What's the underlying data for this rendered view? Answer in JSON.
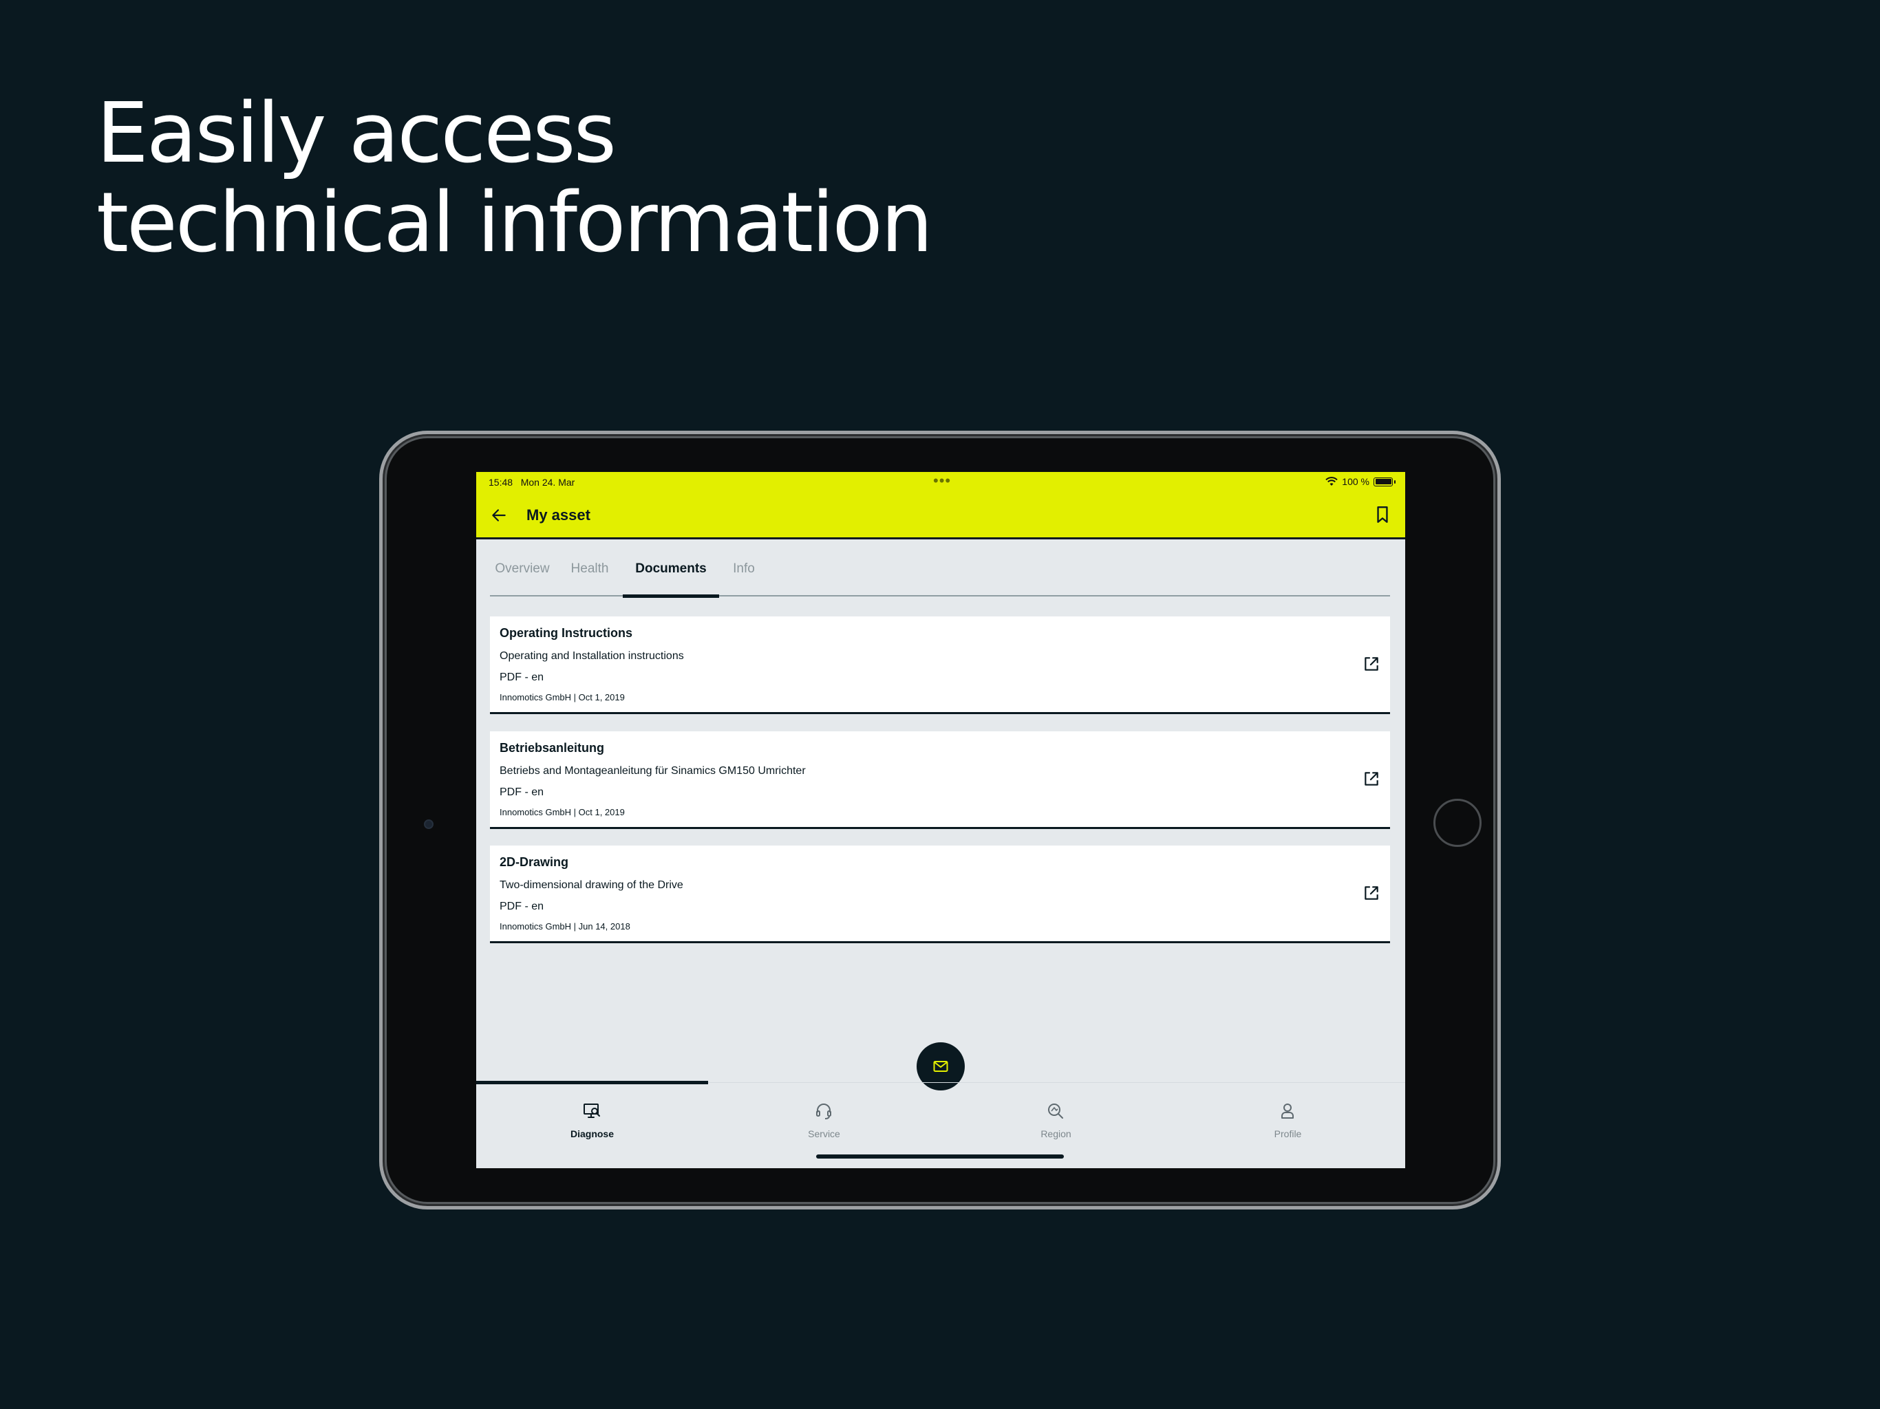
{
  "headline": {
    "line1": "Easily access",
    "line2": "technical information"
  },
  "statusbar": {
    "time": "15:48",
    "date": "Mon 24. Mar",
    "battery": "100 %"
  },
  "appbar": {
    "title": "My asset"
  },
  "tabs": [
    {
      "label": "Overview",
      "active": false
    },
    {
      "label": "Health",
      "active": false
    },
    {
      "label": "Documents",
      "active": true
    },
    {
      "label": "Info",
      "active": false
    }
  ],
  "documents": [
    {
      "title": "Operating Instructions",
      "description": "Operating and Installation instructions",
      "format": "PDF - en",
      "meta": "Innomotics GmbH | Oct 1, 2019"
    },
    {
      "title": "Betriebsanleitung",
      "description": "Betriebs and Montageanleitung für Sinamics GM150 Umrichter",
      "format": "PDF - en",
      "meta": "Innomotics GmbH | Oct 1, 2019"
    },
    {
      "title": "2D-Drawing",
      "description": "Two-dimensional drawing of the Drive",
      "format": "PDF - en",
      "meta": "Innomotics GmbH | Jun 14, 2018"
    }
  ],
  "bottomnav": [
    {
      "label": "Diagnose",
      "icon": "diagnose-icon",
      "active": true
    },
    {
      "label": "Service",
      "icon": "headset-icon",
      "active": false
    },
    {
      "label": "Region",
      "icon": "region-search-icon",
      "active": false
    },
    {
      "label": "Profile",
      "icon": "profile-icon",
      "active": false
    }
  ],
  "colors": {
    "background": "#0a1920",
    "accent": "#e2ef00",
    "screen": "#e5e9ec",
    "card": "#ffffff"
  }
}
